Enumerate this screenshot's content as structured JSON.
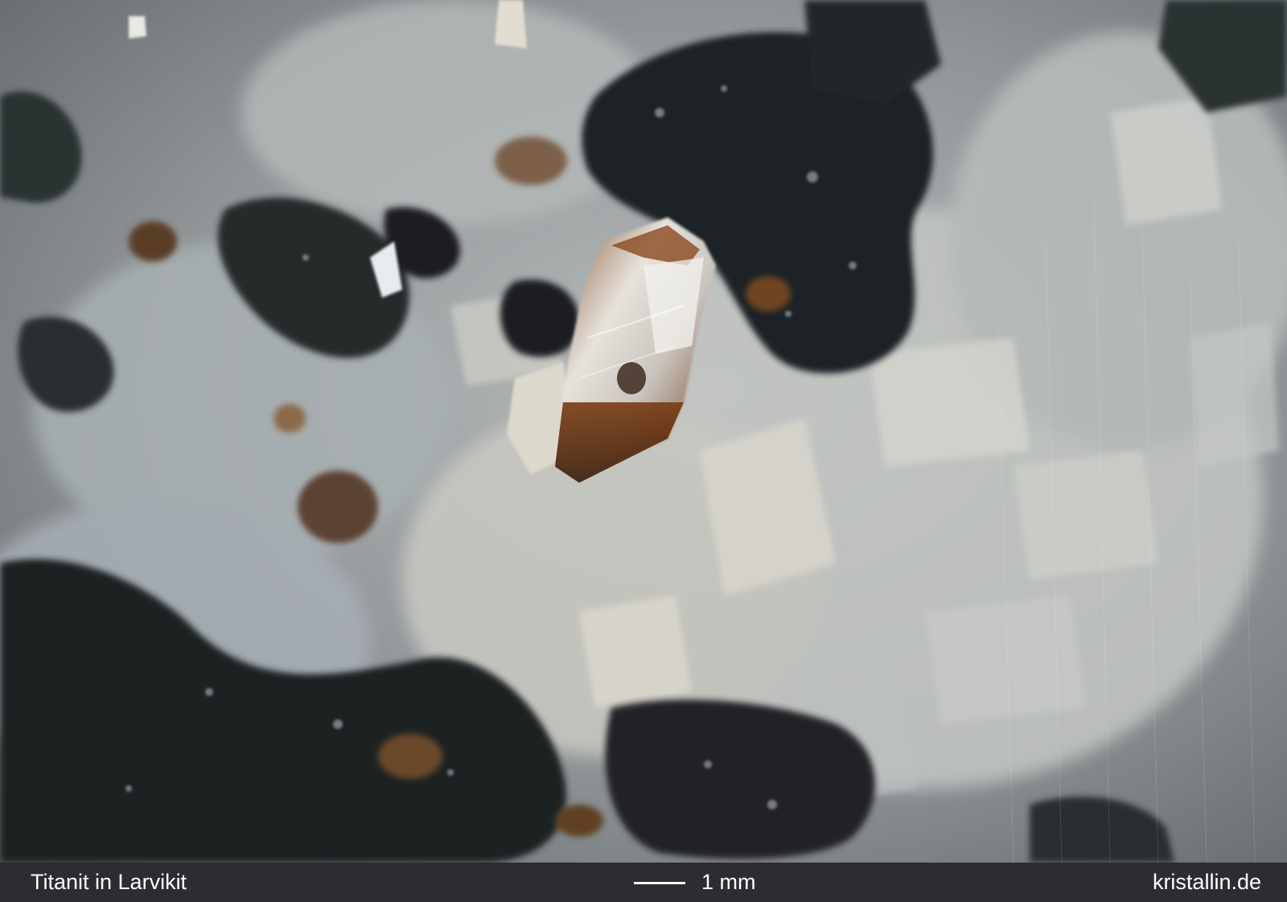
{
  "photo": {
    "subject_description_icon": "mineral-specimen-photo"
  },
  "caption": {
    "title": "Titanit in Larvikit",
    "scale_label": "1 mm",
    "credit": "kristallin.de"
  },
  "colors": {
    "caption_background": "#2b2d30",
    "caption_text": "#ffffff",
    "crystal_brown": "#6b3512",
    "matrix_gray": "#9aa0a3",
    "dark_minerals": "#1e2124"
  }
}
